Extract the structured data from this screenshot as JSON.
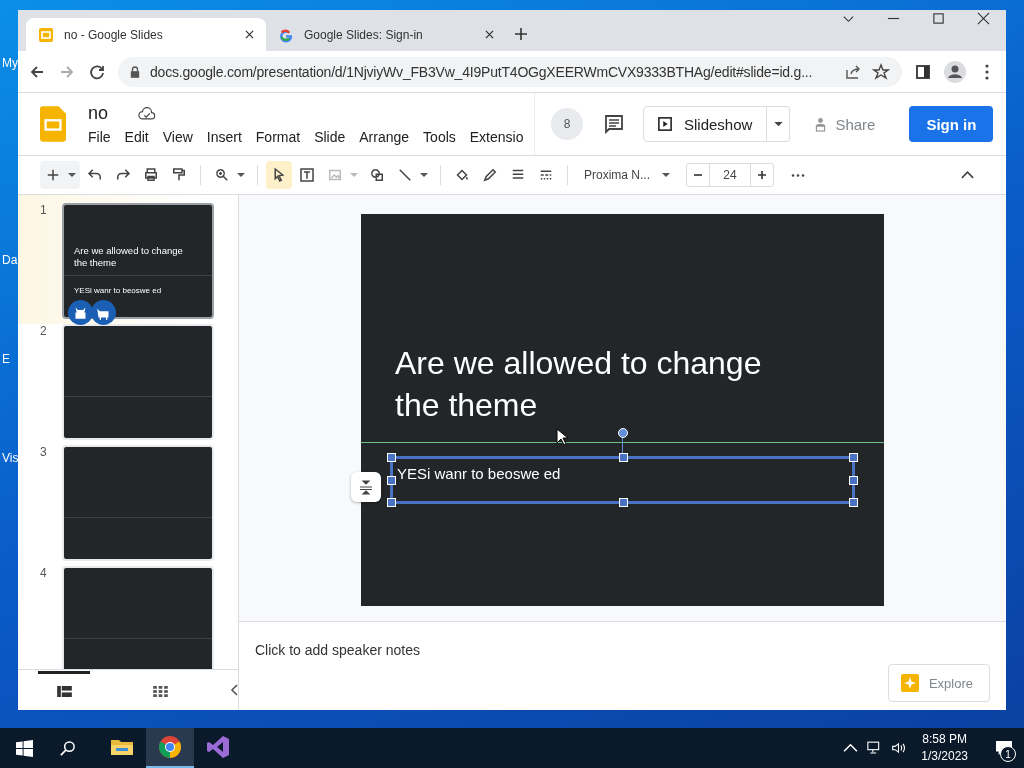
{
  "desktop": {
    "icons": [
      {
        "label": "My"
      },
      {
        "label": "Da"
      },
      {
        "label": "E"
      },
      {
        "label": "Vis"
      }
    ]
  },
  "browser": {
    "tabs": [
      {
        "title": "no - Google Slides",
        "kind": "slides",
        "selected": true
      },
      {
        "title": "Google Slides: Sign-in",
        "kind": "google",
        "selected": false
      }
    ],
    "url": "docs.google.com/presentation/d/1NjviyWv_FB3Vw_4I9PutT4OGgXEERWmCVX9333BTHAg/edit#slide=id.g..."
  },
  "document": {
    "title": "no",
    "menu": [
      "File",
      "Edit",
      "View",
      "Insert",
      "Format",
      "Slide",
      "Arrange",
      "Tools",
      "Extensio"
    ]
  },
  "header": {
    "collaborator_count": "8",
    "slideshow": "Slideshow",
    "share": "Share",
    "sign_in": "Sign in"
  },
  "toolbar": {
    "font": "Proxima N...",
    "font_size": "24"
  },
  "slides": [
    {
      "number": "1",
      "selected": true,
      "title": "Are we allowed to change the theme",
      "body": "YESi wanr to beoswe ed"
    },
    {
      "number": "2",
      "selected": false
    },
    {
      "number": "3",
      "selected": false
    },
    {
      "number": "4",
      "selected": false
    }
  ],
  "canvas": {
    "title": "Are we allowed to change the theme",
    "body": "YESi wanr to beoswe ed"
  },
  "speaker_notes": {
    "placeholder": "Click to add speaker notes"
  },
  "explore": "Explore",
  "filmstrip_views": [
    {
      "kind": "list",
      "selected": true
    },
    {
      "kind": "grid",
      "selected": false
    }
  ],
  "taskbar": {
    "apps": [
      {
        "kind": "explorer",
        "active": false
      },
      {
        "kind": "chrome",
        "active": true
      },
      {
        "kind": "studio",
        "active": false
      }
    ],
    "time": "8:58 PM",
    "date": "1/3/2023",
    "notification_count": "1"
  }
}
